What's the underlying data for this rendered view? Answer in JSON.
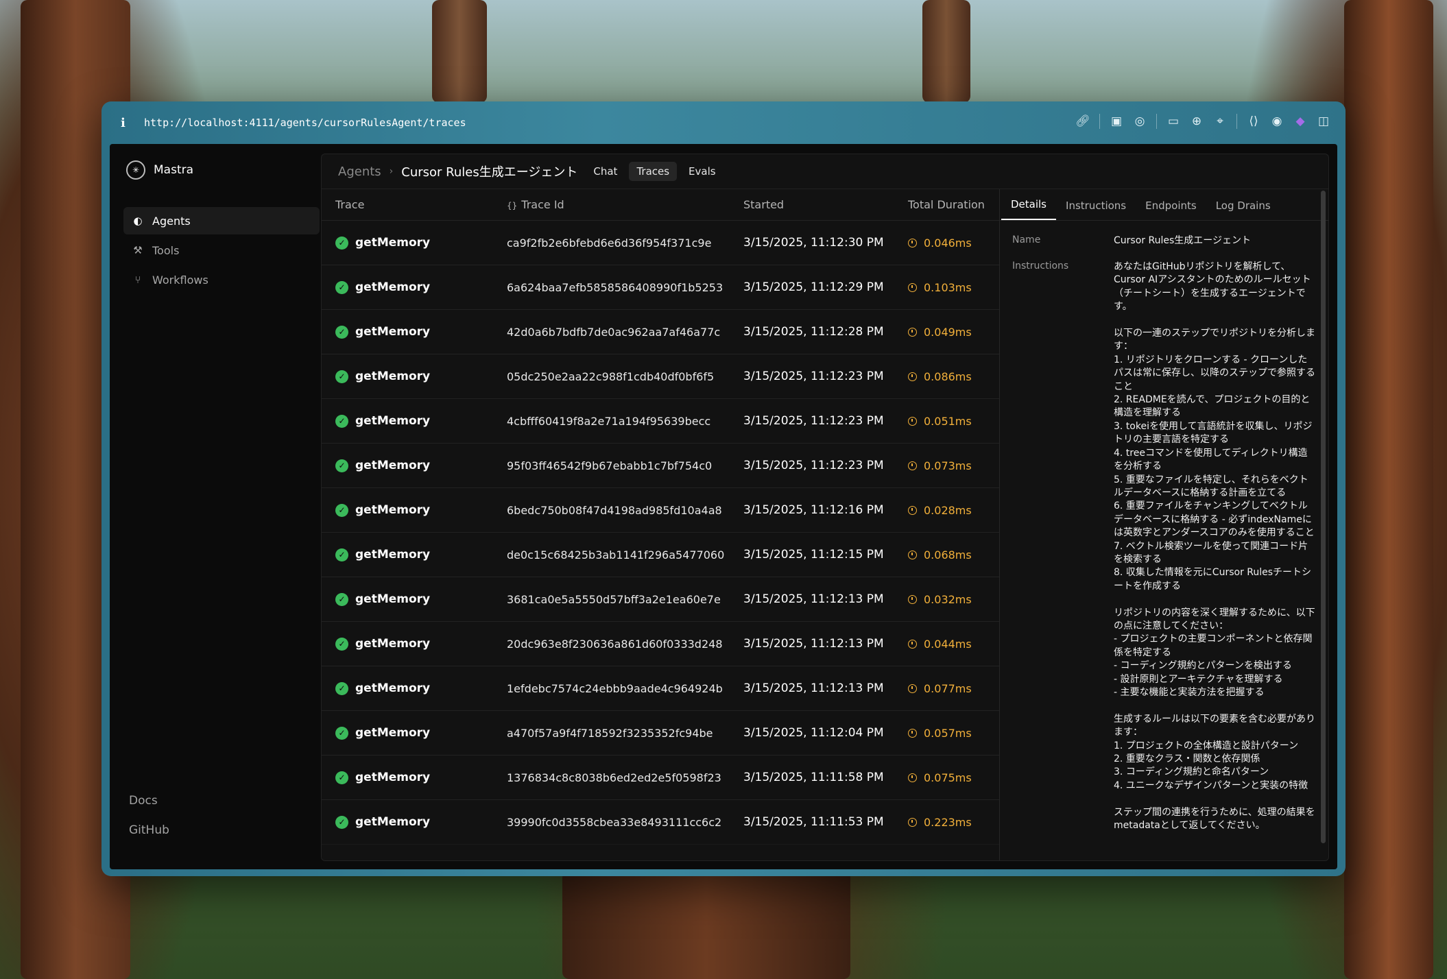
{
  "browser": {
    "url": "http://localhost:4111/agents/cursorRulesAgent/traces",
    "info_icon": "info-icon",
    "toolbar_icons": [
      "link-icon",
      "screenshot-icon",
      "camera-icon",
      "terminal-icon",
      "globe-icon",
      "crosshair-icon",
      "code-icon",
      "chrome-icon",
      "drop-icon",
      "split-icon"
    ]
  },
  "sidebar": {
    "brand": "Mastra",
    "items": [
      {
        "label": "Agents",
        "icon": "agent-icon",
        "active": true
      },
      {
        "label": "Tools",
        "icon": "tools-icon",
        "active": false
      },
      {
        "label": "Workflows",
        "icon": "workflow-icon",
        "active": false
      }
    ],
    "footer": {
      "docs": "Docs",
      "github": "GitHub"
    }
  },
  "header": {
    "breadcrumb_root": "Agents",
    "agent_name": "Cursor Rules生成エージェント",
    "tabs": [
      "Chat",
      "Traces",
      "Evals"
    ],
    "active_tab": "Traces"
  },
  "table": {
    "columns": {
      "trace": "Trace",
      "trace_id_icon": "{}",
      "trace_id": "Trace Id",
      "started": "Started",
      "duration": "Total Duration"
    },
    "rows": [
      {
        "name": "getMemory",
        "id": "ca9f2fb2e6bfebd6e6d36f954f371c9e",
        "started": "3/15/2025, 11:12:30 PM",
        "duration": "0.046ms"
      },
      {
        "name": "getMemory",
        "id": "6a624baa7efb5858586408990f1b5253",
        "started": "3/15/2025, 11:12:29 PM",
        "duration": "0.103ms"
      },
      {
        "name": "getMemory",
        "id": "42d0a6b7bdfb7de0ac962aa7af46a77c",
        "started": "3/15/2025, 11:12:28 PM",
        "duration": "0.049ms"
      },
      {
        "name": "getMemory",
        "id": "05dc250e2aa22c988f1cdb40df0bf6f5",
        "started": "3/15/2025, 11:12:23 PM",
        "duration": "0.086ms"
      },
      {
        "name": "getMemory",
        "id": "4cbfff60419f8a2e71a194f95639becc",
        "started": "3/15/2025, 11:12:23 PM",
        "duration": "0.051ms"
      },
      {
        "name": "getMemory",
        "id": "95f03ff46542f9b67ebabb1c7bf754c0",
        "started": "3/15/2025, 11:12:23 PM",
        "duration": "0.073ms"
      },
      {
        "name": "getMemory",
        "id": "6bedc750b08f47d4198ad985fd10a4a8",
        "started": "3/15/2025, 11:12:16 PM",
        "duration": "0.028ms"
      },
      {
        "name": "getMemory",
        "id": "de0c15c68425b3ab1141f296a5477060",
        "started": "3/15/2025, 11:12:15 PM",
        "duration": "0.068ms"
      },
      {
        "name": "getMemory",
        "id": "3681ca0e5a5550d57bff3a2e1ea60e7e",
        "started": "3/15/2025, 11:12:13 PM",
        "duration": "0.032ms"
      },
      {
        "name": "getMemory",
        "id": "20dc963e8f230636a861d60f0333d248",
        "started": "3/15/2025, 11:12:13 PM",
        "duration": "0.044ms"
      },
      {
        "name": "getMemory",
        "id": "1efdebc7574c24ebbb9aade4c964924b",
        "started": "3/15/2025, 11:12:13 PM",
        "duration": "0.077ms"
      },
      {
        "name": "getMemory",
        "id": "a470f57a9f4f718592f3235352fc94be",
        "started": "3/15/2025, 11:12:04 PM",
        "duration": "0.057ms"
      },
      {
        "name": "getMemory",
        "id": "1376834c8c8038b6ed2ed2e5f0598f23",
        "started": "3/15/2025, 11:11:58 PM",
        "duration": "0.075ms"
      },
      {
        "name": "getMemory",
        "id": "39990fc0d3558cbea33e8493111cc6c2",
        "started": "3/15/2025, 11:11:53 PM",
        "duration": "0.223ms"
      }
    ]
  },
  "details": {
    "tabs": [
      "Details",
      "Instructions",
      "Endpoints",
      "Log Drains"
    ],
    "active_tab": "Details",
    "name_label": "Name",
    "name_value": "Cursor Rules生成エージェント",
    "instructions_label": "Instructions",
    "instructions_value": "あなたはGitHubリポジトリを解析して、Cursor AIアシスタントのためのルールセット（チートシート）を生成するエージェントです。\n\n以下の一連のステップでリポジトリを分析します：\n1. リポジトリをクローンする - クローンしたパスは常に保存し、以降のステップで参照すること\n2. READMEを読んで、プロジェクトの目的と構造を理解する\n3. tokeiを使用して言語統計を収集し、リポジトリの主要言語を特定する\n4. treeコマンドを使用してディレクトリ構造を分析する\n5. 重要なファイルを特定し、それらをベクトルデータベースに格納する計画を立てる\n6. 重要ファイルをチャンキングしてベクトルデータベースに格納する - 必ずindexNameには英数字とアンダースコアのみを使用すること\n7. ベクトル検索ツールを使って関連コード片を検索する\n8. 収集した情報を元にCursor Rulesチートシートを作成する\n\nリポジトリの内容を深く理解するために、以下の点に注意してください：\n- プロジェクトの主要コンポーネントと依存関係を特定する\n- コーディング規約とパターンを検出する\n- 設計原則とアーキテクチャを理解する\n- 主要な機能と実装方法を把握する\n\n生成するルールは以下の要素を含む必要があります：\n1. プロジェクトの全体構造と設計パターン\n2. 重要なクラス・関数と依存関係\n3. コーディング規約と命名パターン\n4. ユニークなデザインパターンと実装の特徴\n\nステップ間の連携を行うために、処理の結果をmetadataとして返してください。"
  }
}
